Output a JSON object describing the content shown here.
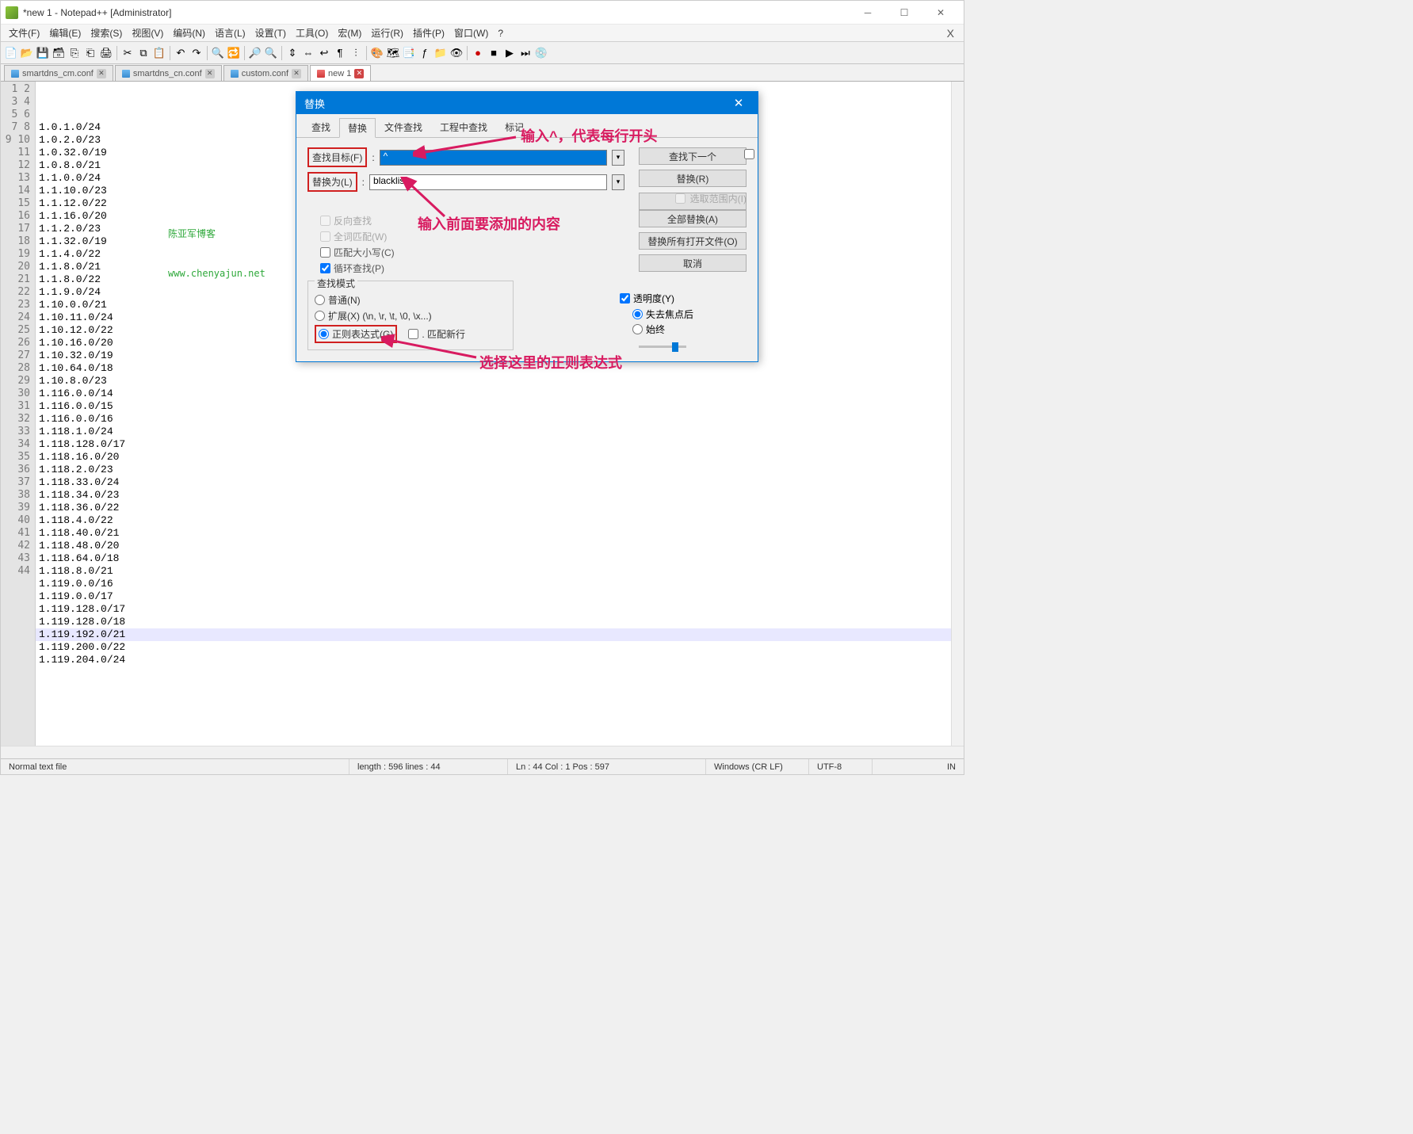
{
  "title": "*new 1 - Notepad++ [Administrator]",
  "menu": [
    "文件(F)",
    "编辑(E)",
    "搜索(S)",
    "视图(V)",
    "编码(N)",
    "语言(L)",
    "设置(T)",
    "工具(O)",
    "宏(M)",
    "运行(R)",
    "插件(P)",
    "窗口(W)",
    "?"
  ],
  "tabs": [
    {
      "label": "smartdns_cm.conf",
      "active": false,
      "icon": "blue",
      "close": "grey"
    },
    {
      "label": "smartdns_cn.conf",
      "active": false,
      "icon": "blue",
      "close": "grey"
    },
    {
      "label": "custom.conf",
      "active": false,
      "icon": "blue",
      "close": "grey"
    },
    {
      "label": "new 1",
      "active": true,
      "icon": "red",
      "close": "red"
    }
  ],
  "code_lines": [
    "1.0.1.0/24",
    "1.0.2.0/23",
    "1.0.32.0/19",
    "1.0.8.0/21",
    "1.1.0.0/24",
    "1.1.10.0/23",
    "1.1.12.0/22",
    "1.1.16.0/20",
    "1.1.2.0/23",
    "1.1.32.0/19",
    "1.1.4.0/22",
    "1.1.8.0/21",
    "1.1.8.0/22",
    "1.1.9.0/24",
    "1.10.0.0/21",
    "1.10.11.0/24",
    "1.10.12.0/22",
    "1.10.16.0/20",
    "1.10.32.0/19",
    "1.10.64.0/18",
    "1.10.8.0/23",
    "1.116.0.0/14",
    "1.116.0.0/15",
    "1.116.0.0/16",
    "1.118.1.0/24",
    "1.118.128.0/17",
    "1.118.16.0/20",
    "1.118.2.0/23",
    "1.118.33.0/24",
    "1.118.34.0/23",
    "1.118.36.0/22",
    "1.118.4.0/22",
    "1.118.40.0/21",
    "1.118.48.0/20",
    "1.118.64.0/18",
    "1.118.8.0/21",
    "1.119.0.0/16",
    "1.119.0.0/17",
    "1.119.128.0/17",
    "1.119.128.0/18",
    "1.119.192.0/21",
    "1.119.200.0/22",
    "1.119.204.0/24"
  ],
  "watermark": {
    "line1": "陈亚军博客",
    "line2": "www.chenyajun.net"
  },
  "dialog": {
    "title": "替换",
    "tabs": [
      "查找",
      "替换",
      "文件查找",
      "工程中查找",
      "标记"
    ],
    "active_tab": "替换",
    "find_label": "查找目标(F)",
    "find_value": "^",
    "replace_label": "替换为(L)",
    "replace_value": "blacklist-",
    "buttons": {
      "find_next": "查找下一个",
      "replace": "替换(R)",
      "replace_all": "全部替换(A)",
      "replace_all_open": "替换所有打开文件(O)",
      "cancel": "取消"
    },
    "checks": {
      "backward": "反向查找",
      "whole": "全词匹配(W)",
      "match_case": "匹配大小写(C)",
      "wrap": "循环查找(P)",
      "in_selection": "选取范围内(I)",
      "match_newline": ". 匹配新行"
    },
    "mode": {
      "legend": "查找模式",
      "normal": "普通(N)",
      "extended": "扩展(X) (\\n, \\r, \\t, \\0, \\x...)",
      "regex": "正则表达式(G)"
    },
    "transparency": {
      "label": "透明度(Y)",
      "on_lose": "失去焦点后",
      "always": "始终"
    }
  },
  "annotations": {
    "a1": "输入^，代表每行开头",
    "a2": "输入前面要添加的内容",
    "a3": "选择这里的正则表达式"
  },
  "status": {
    "filetype": "Normal text file",
    "length": "length : 596    lines : 44",
    "pos": "Ln : 44    Col : 1    Pos : 597",
    "eol": "Windows (CR LF)",
    "enc": "UTF-8",
    "ins": "IN"
  }
}
